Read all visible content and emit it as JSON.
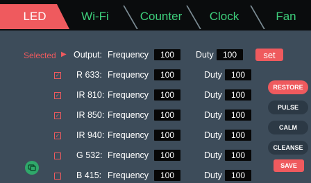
{
  "tabs": [
    "LED",
    "Wi-Fi",
    "Counter",
    "Clock",
    "Fan"
  ],
  "selected_label": "Selected",
  "output_row": {
    "label": "Output:",
    "frequency_label": "Frequency",
    "frequency": "100",
    "duty_label": "Duty",
    "duty": "100",
    "set_label": "set"
  },
  "channels": [
    {
      "name": "R 633:",
      "checked": true,
      "frequency_label": "Frequency",
      "frequency": "100",
      "duty_label": "Duty",
      "duty": "100"
    },
    {
      "name": "IR 810:",
      "checked": true,
      "frequency_label": "Frequency",
      "frequency": "100",
      "duty_label": "Duty",
      "duty": "100"
    },
    {
      "name": "IR 850:",
      "checked": true,
      "frequency_label": "Frequency",
      "frequency": "100",
      "duty_label": "Duty",
      "duty": "100"
    },
    {
      "name": "IR 940:",
      "checked": true,
      "frequency_label": "Frequency",
      "frequency": "100",
      "duty_label": "Duty",
      "duty": "100"
    },
    {
      "name": "G 532:",
      "checked": false,
      "frequency_label": "Frequency",
      "frequency": "100",
      "duty_label": "Duty",
      "duty": "100"
    },
    {
      "name": "B 415:",
      "checked": false,
      "frequency_label": "Frequency",
      "frequency": "100",
      "duty_label": "Duty",
      "duty": "100"
    }
  ],
  "side_buttons": [
    "RESTORE",
    "PULSE",
    "CALM",
    "CLEANSE"
  ],
  "save_label": "SAVE",
  "icons": {
    "selected_marker": "triangle-right-icon",
    "chat": "chat-bubble-icon",
    "check": "check-icon"
  },
  "colors": {
    "accent": "#ef5a5e",
    "tab_text": "#3ed07c",
    "background": "#3d4c5a",
    "value_box": "#070707"
  }
}
